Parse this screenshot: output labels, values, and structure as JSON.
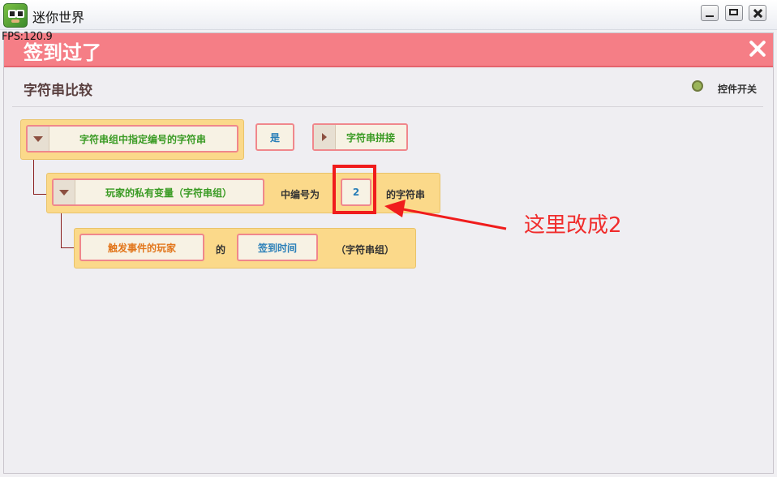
{
  "window": {
    "title": "迷你世界",
    "fps": "FPS:120.9"
  },
  "dialog": {
    "title": "签到过了",
    "section_title": "字符串比较",
    "toggle_label": "控件开关"
  },
  "row1": {
    "func_label": "字符串组中指定编号的字符串",
    "equals_label": "是",
    "concat_label": "字符串拼接"
  },
  "row2": {
    "var_label": "玩家的私有变量（字符串组）",
    "mid_text": "中编号为",
    "index_value": "2",
    "suffix_text": "的字符串"
  },
  "row3": {
    "player_label": "触发事件的玩家",
    "of_text": "的",
    "var_name": "签到时间",
    "type_text": "（字符串组）"
  },
  "annotation": {
    "text": "这里改成2"
  },
  "colors": {
    "header": "#f57e86",
    "block": "#fbd98a",
    "chip_border": "#f0878c",
    "annotation": "#f02c2c"
  }
}
